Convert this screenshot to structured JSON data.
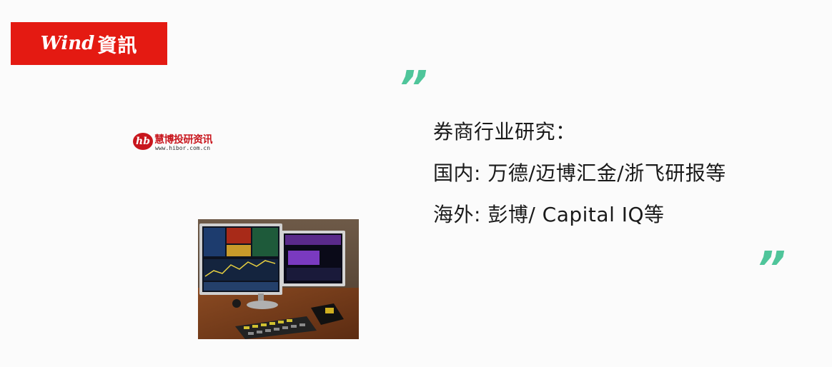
{
  "logos": {
    "wind": {
      "latin": "Wind",
      "cjk": "資訊",
      "color": "#e41a12"
    },
    "hibor": {
      "mark": "hb",
      "name": "慧博投研资讯",
      "url": "www.hibor.com.cn",
      "color": "#c8161d"
    }
  },
  "quotes": {
    "open": "”",
    "close": "”",
    "color": "#4fc59a"
  },
  "content": {
    "lines": [
      "券商行业研究：",
      "国内: 万德/迈博汇金/浙飞研报等",
      "海外: 彭博/ Capital IQ等"
    ]
  },
  "photo": {
    "subject": "bloomberg-terminal-dual-monitor-desk"
  }
}
